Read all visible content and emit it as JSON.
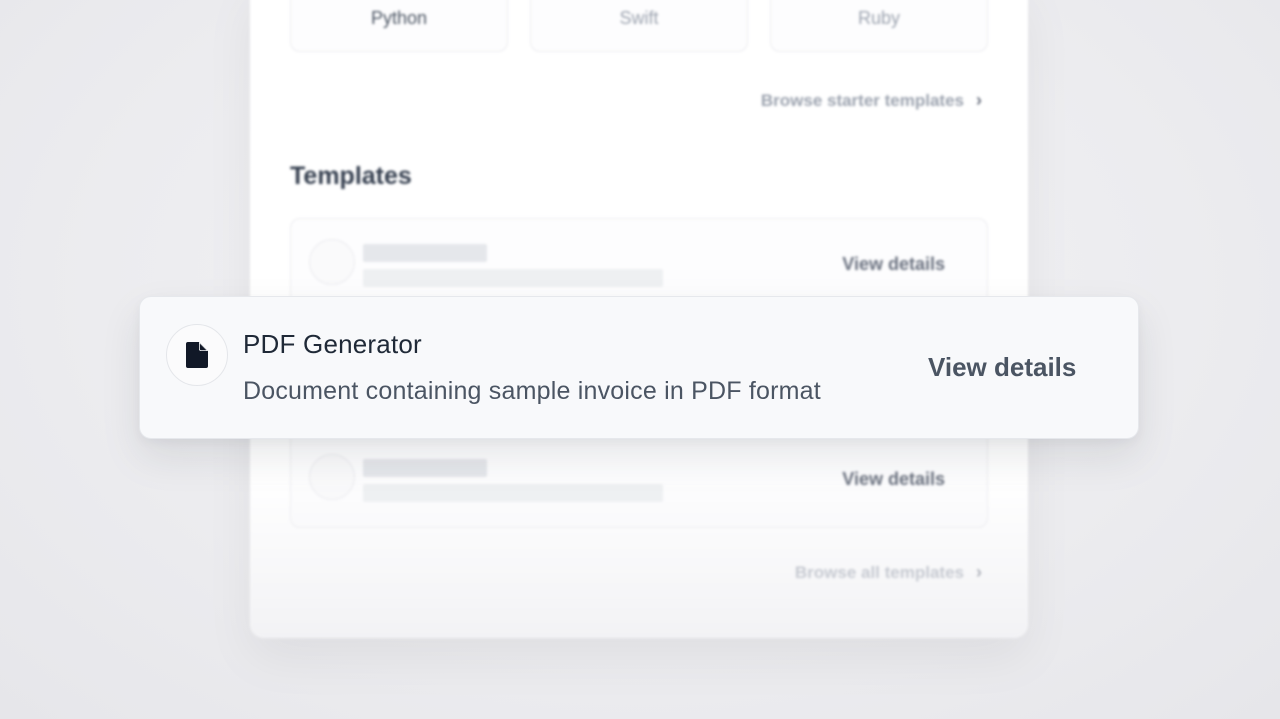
{
  "languages": [
    {
      "label": "Python"
    },
    {
      "label": "Swift"
    },
    {
      "label": "Ruby"
    }
  ],
  "starter": {
    "link_label": "Browse starter templates",
    "chevron": "›"
  },
  "templates": {
    "title": "Templates",
    "rows": [
      {
        "action": "View details"
      },
      {
        "action": "View details"
      }
    ],
    "browse_all": "Browse all templates",
    "chevron": "›"
  },
  "focused": {
    "icon": "document-icon",
    "title": "PDF Generator",
    "description": "Document containing sample invoice in PDF format",
    "action": "View details"
  },
  "colors": {
    "background": "#ededf0",
    "card": "#f8f9fb",
    "text_primary": "#1f2937",
    "text_secondary": "#4b5563"
  }
}
